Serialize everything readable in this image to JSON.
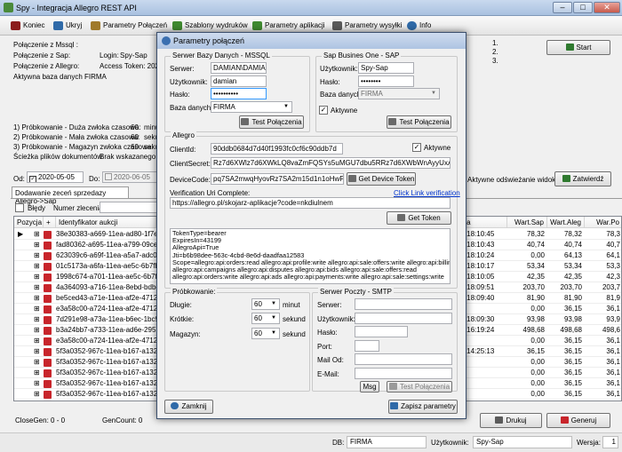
{
  "window": {
    "title": "Spy - Integracja Allegro REST API"
  },
  "menu": {
    "items": [
      {
        "label": "Koniec",
        "color": "#8b1c1c"
      },
      {
        "label": "Ukryj",
        "color": "#2f6aa8"
      },
      {
        "label": "Parametry Połączeń",
        "color": "#a07a2a"
      },
      {
        "label": "Szablony wydruków",
        "color": "#3f8a2f"
      },
      {
        "label": "Parametry aplikacji",
        "color": "#3f8a2f"
      },
      {
        "label": "Parametry wysyłki",
        "color": "#5a5a5a"
      },
      {
        "label": "Info",
        "color": "#2f6aa8"
      }
    ]
  },
  "left_panel": {
    "conn_mssql": "Połączenie z Mssql :",
    "conn_sap": "Połączenie z Sap:",
    "login_label": "Login:",
    "login_value": "Spy-Sap",
    "conn_allegro": "Połączenie z Allegro:",
    "token_label": "Access Token: 2020-0",
    "active_db_label": "Aktywna baza danych :",
    "active_db_value": "FIRMA",
    "probe1": "1) Próbkowanie - Duża zwłoka czasowa:",
    "probe1_val": "60",
    "probe1_unit": "minut",
    "probe2": "2) Próbkowanie - Mała zwłoka czasowa:",
    "probe2_val": "60",
    "probe2_unit": "sekun",
    "probe3": "3) Próbkowanie - Magazyn zwłoka czasowa:",
    "probe3_val": "60",
    "probe3_unit": "sekun",
    "docs_path": "Ścieżka plików dokumentów:",
    "docs_path_value": "Brak wskazanego folder"
  },
  "right_panel": {
    "list": [
      "1.",
      "2.",
      "3."
    ],
    "start_label": "Start",
    "auto_refresh": "Aktywne odświeżanie widoku",
    "confirm_label": "Zatwierdź"
  },
  "filter": {
    "from_label": "Od:",
    "from_value": "2020-05-05",
    "to_label": "Do:",
    "to_value": "2020-06-05"
  },
  "tab": {
    "label": "Dodawanie zeceń sprzedazy Allegro->Sap"
  },
  "grid_filter": {
    "errors_label": "Błędy",
    "order_no_label": "Numer zlecenia:"
  },
  "grid": {
    "headers": [
      "Pozycja",
      "+",
      "Identyfikator aukcji",
      "data",
      "Wart.Sap",
      "Wart.Aleg",
      "War.Po"
    ],
    "rows": [
      {
        "id": "38e30383-a669-11ea-ad80-1f7eeca35",
        "date": "05 18:10:45",
        "sap": "78,32",
        "aleg": "78,32",
        "po": "78,3"
      },
      {
        "id": "fad80362-a695-11ea-a799-09cee5ae5",
        "date": "05 18:10:43",
        "sap": "40,74",
        "aleg": "40,74",
        "po": "40,7"
      },
      {
        "id": "623039c6-a69f-11ea-a5a7-adc023afc",
        "date": "05 18:10:24",
        "sap": "0,00",
        "aleg": "64,13",
        "po": "64,1"
      },
      {
        "id": "01c5173a-a6fa-11ea-ae5c-6b7fbfe5b",
        "date": "05 18:10:17",
        "sap": "53,34",
        "aleg": "53,34",
        "po": "53,3"
      },
      {
        "id": "1998c674-a701-11ea-ae5c-6b7fbfe5b",
        "date": "05 18:10:05",
        "sap": "42,35",
        "aleg": "42,35",
        "po": "42,3"
      },
      {
        "id": "4a364093-a716-11ea-8ebd-bdbcf8d3b",
        "date": "05 18:09:51",
        "sap": "203,70",
        "aleg": "203,70",
        "po": "203,7"
      },
      {
        "id": "be5ced43-a71e-11ea-af2e-4712be0fd",
        "date": "05 18:09:40",
        "sap": "81,90",
        "aleg": "81,90",
        "po": "81,9"
      },
      {
        "id": "e3a58c00-a724-11ea-af2e-4712be0fd",
        "date": "",
        "sap": "0,00",
        "aleg": "36,15",
        "po": "36,1"
      },
      {
        "id": "7d291e98-a73a-11ea-b6ec-1bc98c96",
        "date": "05 18:09:30",
        "sap": "93,98",
        "aleg": "93,98",
        "po": "93,9"
      },
      {
        "id": "b3a24bb7-a733-11ea-ad6e-29571d16",
        "date": "05 16:19:24",
        "sap": "498,68",
        "aleg": "498,68",
        "po": "498,6"
      },
      {
        "id": "e3a58c00-a724-11ea-af2e-4712be0fd",
        "date": "",
        "sap": "0,00",
        "aleg": "36,15",
        "po": "36,1"
      },
      {
        "id": "5f3a0352-967c-11ea-b167-a1325306b",
        "date": "05 14:25:13",
        "sap": "36,15",
        "aleg": "36,15",
        "po": "36,1"
      },
      {
        "id": "5f3a0352-967c-11ea-b167-a1325306b",
        "date": "",
        "sap": "0,00",
        "aleg": "36,15",
        "po": "36,1"
      },
      {
        "id": "5f3a0352-967c-11ea-b167-a1325306b",
        "date": "",
        "sap": "0,00",
        "aleg": "36,15",
        "po": "36,1"
      },
      {
        "id": "5f3a0352-967c-11ea-b167-a1325306b",
        "date": "",
        "sap": "0,00",
        "aleg": "36,15",
        "po": "36,1"
      },
      {
        "id": "5f3a0352-967c-11ea-b167-a1325306b",
        "date": "",
        "sap": "0,00",
        "aleg": "36,15",
        "po": "36,1"
      }
    ]
  },
  "bottom": {
    "close_gen": "CloseGen: 0 - 0",
    "gen_count": "GenCount: 0",
    "print_label": "Drukuj",
    "generate_label": "Generuj"
  },
  "status": {
    "db_label": "DB:",
    "db_value": "FIRMA",
    "user_label": "Użytkownik:",
    "user_value": "Spy-Sap",
    "version_label": "Wersja:",
    "version_value": "1"
  },
  "dialog": {
    "title": "Parametry połączeń",
    "mssql": {
      "group": "Serwer Bazy Danych - MSSQL",
      "server_label": "Serwer:",
      "server_value": "DAMIAN\\DAMIAN",
      "user_label": "Użytkownik:",
      "user_value": "damian",
      "pass_label": "Hasło:",
      "pass_value": "••••••••••",
      "db_label": "Baza danych:",
      "db_value": "FIRMA",
      "test_label": "Test Połączenia"
    },
    "sap": {
      "group": "Sap Busines One - SAP",
      "user_label": "Użytkownik:",
      "user_value": "Spy-Sap",
      "pass_label": "Hasło:",
      "pass_value": "••••••••",
      "db_label": "Baza danych:",
      "db_value": "FIRMA",
      "active_label": "Aktywne",
      "test_label": "Test Połączenia"
    },
    "allegro": {
      "group": "Allegro",
      "client_id_label": "ClientId:",
      "client_id_value": "90ddb0684d7d40f1993fc0cf6c90ddb7d",
      "active_label": "Aktywne",
      "client_secret_label": "ClientSecret:",
      "client_secret_value": "Rz7d6XWlz7d6XWkLQ8vaZmFQSYs5uMGU7dbu5RRz7d6XWbWnAyyUxAR6gbIITV",
      "device_code_label": "DeviceCode:",
      "device_code_value": "pq7SA2mwqHyovRz7SA2m15d1n1oHwPrz",
      "get_device_token_label": "Get Device Token",
      "verification_label": "Verification Uri Complete:",
      "click_link": "Click Link verification",
      "verification_value": "https://allegro.pl/skojarz-aplikacje?code=nkdiulnem",
      "get_token_label": "Get Token",
      "token_text": "TokenType=bearer\nExpiresIn=43199\nAllegroApi=True\nJti=b6b98dee-563c-4cbd-8e6d-daadfaa12583\nScope=allegro:api:orders:read allegro:api:profile:write allegro:api:sale:offers:write allegro:api:billing:read\nallegro:api:campaigns allegro:api:disputes allegro:api:bids allegro:api:sale:offers:read\nallegro:api:orders:write allegro:api:ads allegro:api:payments:write allegro:api:sale:settings:write"
    },
    "probing": {
      "group": "Próbkowanie:",
      "long_label": "Długie:",
      "long_value": "60",
      "long_unit": "minut",
      "short_label": "Krótkie:",
      "short_value": "60",
      "short_unit": "sekund",
      "store_label": "Magazyn:",
      "store_value": "60",
      "store_unit": "sekund"
    },
    "smtp": {
      "group": "Serwer Poczty - SMTP",
      "server_label": "Serwer:",
      "user_label": "Użytkownik:",
      "pass_label": "Hasło:",
      "port_label": "Port:",
      "mail_from_label": "Mail Od:",
      "email_label": "E-Mail:",
      "msg_label": "Msg",
      "test_label": "Test Połączenia"
    },
    "close_label": "Zamknij",
    "save_label": "Zapisz parametry"
  }
}
